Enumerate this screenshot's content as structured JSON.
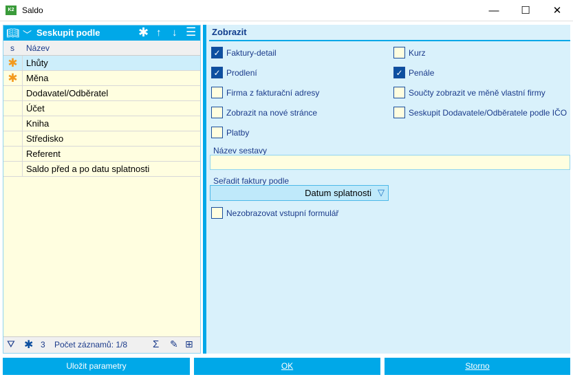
{
  "window": {
    "title": "Saldo",
    "logo_text": "K2",
    "minimize": "—",
    "maximize": "☐",
    "close": "✕"
  },
  "left_panel": {
    "header_title": "Seskupit podle",
    "columns": {
      "s": "s",
      "name": "Název"
    },
    "rows": [
      {
        "name": "Lhůty",
        "star": true,
        "selected": true
      },
      {
        "name": "Měna",
        "star": true
      },
      {
        "name": "Dodavatel/Odběratel"
      },
      {
        "name": "Účet"
      },
      {
        "name": "Kniha"
      },
      {
        "name": "Středisko"
      },
      {
        "name": "Referent"
      },
      {
        "name": "Saldo před a po datu splatnosti"
      }
    ],
    "footer": {
      "star_count": "3",
      "record_count": "Počet záznamů: 1/8"
    }
  },
  "right_panel": {
    "section_title": "Zobrazit",
    "checkboxes": [
      {
        "label": "Faktury-detail",
        "checked": true
      },
      {
        "label": "Kurz",
        "checked": false
      },
      {
        "label": "Prodlení",
        "checked": true
      },
      {
        "label": "Penále",
        "checked": true
      },
      {
        "label": "Firma z fakturační adresy",
        "checked": false
      },
      {
        "label": "Součty zobrazit ve měně vlastní firmy",
        "checked": false
      },
      {
        "label": "Zobrazit na nové stránce",
        "checked": false
      },
      {
        "label": "Seskupit Dodavatele/Odběratele podle IČO",
        "checked": false
      },
      {
        "label": "Platby",
        "checked": false
      }
    ],
    "report_name_label": "Název sestavy",
    "report_name_value": "",
    "sort_label": "Seřadit faktury podle",
    "sort_value": "Datum splatnosti",
    "no_input_form": {
      "label": "Nezobrazovat vstupní formulář",
      "checked": false
    }
  },
  "buttons": {
    "save": "Uložit parametry",
    "ok": "OK",
    "cancel": "Storno"
  },
  "colors": {
    "accent": "#00a8e8",
    "panel": "#d9f1fb",
    "list_bg": "#fffee0",
    "selected_row": "#cdeefb",
    "star": "#f39a1e"
  }
}
